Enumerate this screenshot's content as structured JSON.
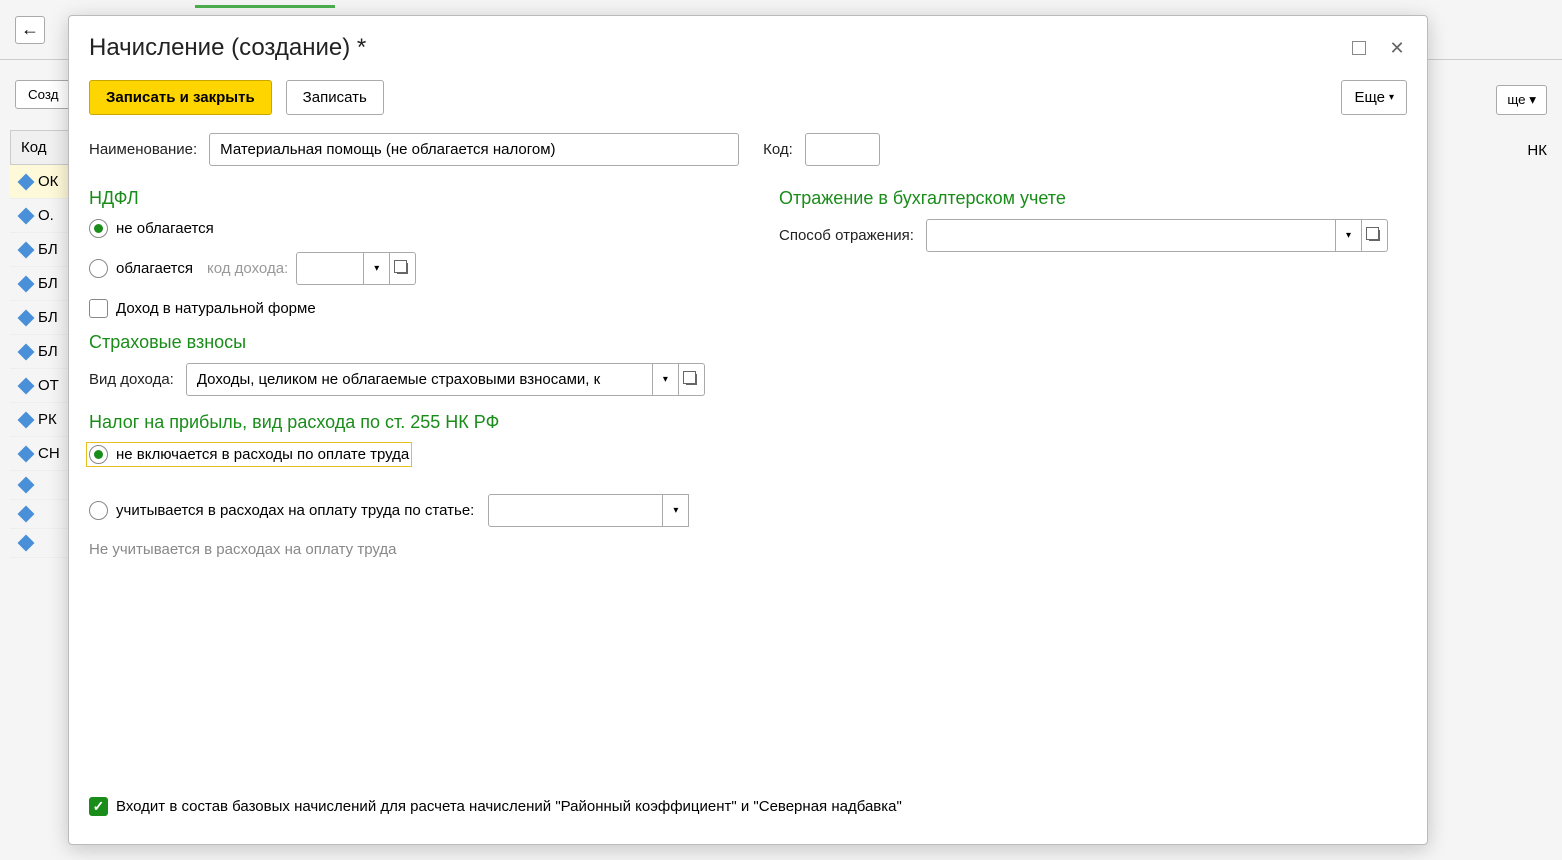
{
  "bg": {
    "create_btn": "Созд",
    "more_btn": "ще",
    "nk_header": "НК",
    "code_header": "Код",
    "rows": [
      "ОК",
      "О.",
      "БЛ",
      "БЛ",
      "БЛ",
      "БЛ",
      "ОТ",
      "РК",
      "СН",
      "",
      "",
      ""
    ]
  },
  "modal": {
    "title": "Начисление (создание) *",
    "toolbar": {
      "save_close": "Записать и закрыть",
      "save": "Записать",
      "more": "Еще"
    },
    "name_label": "Наименование:",
    "name_value": "Материальная помощь (не облагается налогом)",
    "code_label": "Код:",
    "code_value": "",
    "ndfl": {
      "header": "НДФЛ",
      "not_taxed": "не облагается",
      "taxed": "облагается",
      "income_code_hint": "код дохода:",
      "natural_form": "Доход в натуральной форме"
    },
    "insurance": {
      "header": "Страховые взносы",
      "income_type_label": "Вид дохода:",
      "income_type_value": "Доходы, целиком не облагаемые страховыми взносами, к"
    },
    "profit_tax": {
      "header": "Налог на прибыль, вид расхода по ст. 255 НК РФ",
      "not_included": "не включается в расходы по оплате труда",
      "included": "учитывается в расходах на оплату труда по статье:",
      "info": "Не учитывается в расходах на оплату труда"
    },
    "accounting": {
      "header": "Отражение в бухгалтерском учете",
      "method_label": "Способ отражения:",
      "method_value": ""
    },
    "footer": {
      "base_accruals": "Входит в состав базовых начислений для расчета начислений \"Районный коэффициент\" и \"Северная надбавка\""
    }
  }
}
